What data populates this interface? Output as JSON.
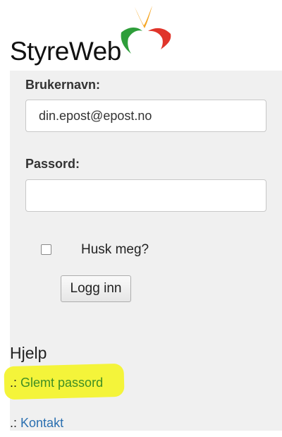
{
  "brand": {
    "name": "StyreWeb"
  },
  "login": {
    "username_label": "Brukernavn:",
    "username_value": "din.epost@epost.no",
    "password_label": "Passord:",
    "password_value": "",
    "remember_label": "Husk meg?",
    "remember_checked": false,
    "submit_label": "Logg inn"
  },
  "help": {
    "heading": "Hjelp",
    "links": [
      {
        "prefix": ".:",
        "label": "Glemt passord",
        "highlighted": true,
        "color": "#3f8f24"
      },
      {
        "prefix": ".:",
        "label": "Kontakt",
        "highlighted": false,
        "color": "#2a6fb0"
      }
    ],
    "highlight_color": "#f4f43a"
  },
  "logo_colors": {
    "top": "#f5a623",
    "left": "#2e9e3a",
    "right": "#e0352b"
  }
}
